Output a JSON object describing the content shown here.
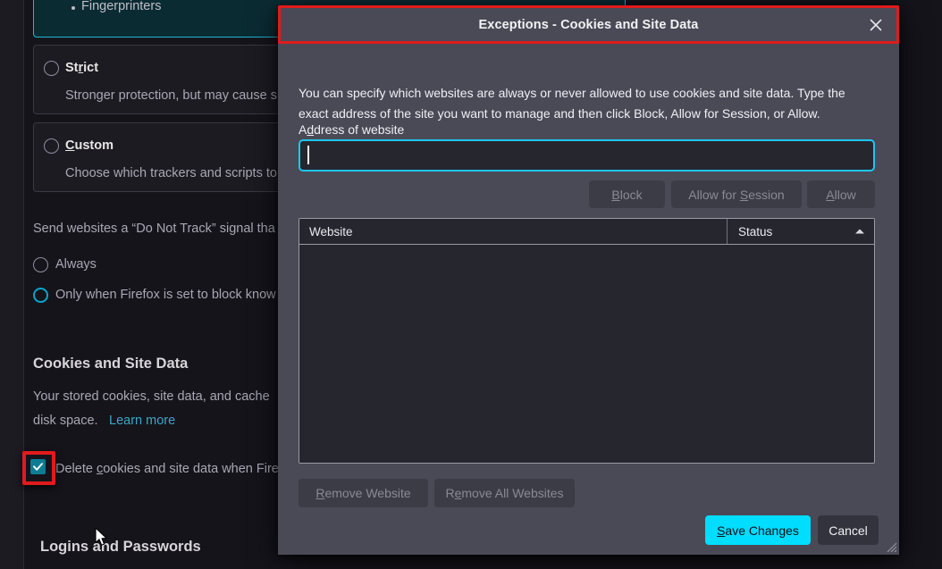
{
  "background": {
    "etp_bullets": [
      {
        "label": "Fingerprinters"
      }
    ],
    "cards": [
      {
        "title": "Strict",
        "title_pre": "St",
        "title_ak": "r",
        "title_post": "ict",
        "desc": "Stronger protection, but may cause s",
        "selected": false
      },
      {
        "title": "Custom",
        "title_pre": "",
        "title_ak": "C",
        "title_post": "ustom",
        "desc": "Choose which trackers and scripts to",
        "selected": false
      }
    ],
    "dnt_text": "Send websites a “Do Not Track” signal tha",
    "dnt_options": [
      {
        "label": "Always",
        "selected": false
      },
      {
        "label": "Only when Firefox is set to block know",
        "selected": true
      }
    ],
    "cookies_heading": "Cookies and Site Data",
    "cookies_desc_line1": "Your stored cookies, site data, and cache",
    "cookies_desc_line2": "disk space.",
    "learn_more": "Learn more",
    "delete_checkbox": {
      "pre": "Delete ",
      "ak": "c",
      "post": "ookies and site data when Fire",
      "checked": true
    },
    "logins_heading": "Logins and Passwords"
  },
  "dialog": {
    "title": "Exceptions - Cookies and Site Data",
    "close_icon": "close-icon",
    "description": "You can specify which websites are always or never allowed to use cookies and site data. Type the exact address of the site you want to manage and then click Block, Allow for Session, or Allow.",
    "address_label_pre": "A",
    "address_label_ak": "d",
    "address_label_post": "dress of website",
    "address_input_value": "",
    "address_input_placeholder": "",
    "action_buttons": [
      {
        "pre": "",
        "ak": "B",
        "post": "lock",
        "enabled": false
      },
      {
        "pre": "Allow for ",
        "ak": "S",
        "post": "ession",
        "enabled": false
      },
      {
        "pre": "",
        "ak": "A",
        "post": "llow",
        "enabled": false
      }
    ],
    "table": {
      "columns": [
        {
          "label": "Website",
          "sorted": false
        },
        {
          "label": "Status",
          "sorted": true,
          "direction": "ascending"
        }
      ],
      "rows": []
    },
    "remove_buttons": [
      {
        "pre": "",
        "ak": "R",
        "post": "emove Website",
        "enabled": false
      },
      {
        "pre": "R",
        "ak": "e",
        "post": "move All Websites",
        "enabled": false
      }
    ],
    "footer_buttons": [
      {
        "pre": "",
        "ak": "S",
        "post": "ave Changes",
        "kind": "primary"
      },
      {
        "pre": "Cancel",
        "ak": "",
        "post": "",
        "kind": "neutral"
      }
    ],
    "resize_grip": "resize-grip-icon"
  },
  "colors": {
    "accent_cyan": "#00ddff",
    "focus_cyan": "#1ec6f0",
    "highlight_red": "#e01b1b",
    "checkbox_teal": "#0e7c94",
    "dialog_bg": "#4a4a57",
    "page_bg": "#15141b",
    "link_blue": "#3ba8c4"
  }
}
